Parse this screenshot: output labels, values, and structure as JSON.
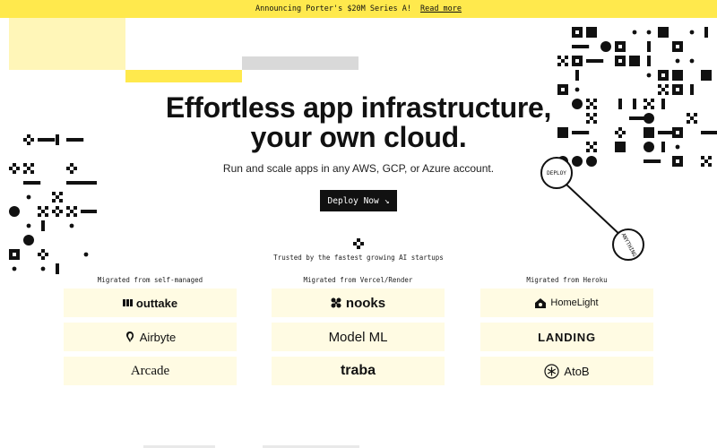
{
  "banner": {
    "text": "Announcing Porter's $20M Series A!",
    "link": "Read more"
  },
  "hero": {
    "title_line1": "Effortless app infrastructure,",
    "title_line2": "your own cloud.",
    "subtitle": "Run and scale apps in any AWS, GCP, or Azure account.",
    "cta_label": "Deploy Now",
    "cta_arrow": "↘"
  },
  "diagram": {
    "node_start": "DEPLOY",
    "node_end": "ANYTHING"
  },
  "trusted": {
    "text": "Trusted by the fastest growing AI startups"
  },
  "columns": [
    {
      "label": "Migrated from self-managed",
      "logos": [
        "outtake",
        "Airbyte",
        "Arcade"
      ]
    },
    {
      "label": "Migrated from Vercel/Render",
      "logos": [
        "nooks",
        "Model ML",
        "traba"
      ]
    },
    {
      "label": "Migrated from Heroku",
      "logos": [
        "HomeLight",
        "LANDING",
        "AtoB"
      ]
    }
  ],
  "colors": {
    "accent_yellow": "#ffe94d",
    "pale_yellow": "#fff6b8",
    "card_bg": "#fffbe3",
    "ink": "#111111"
  }
}
